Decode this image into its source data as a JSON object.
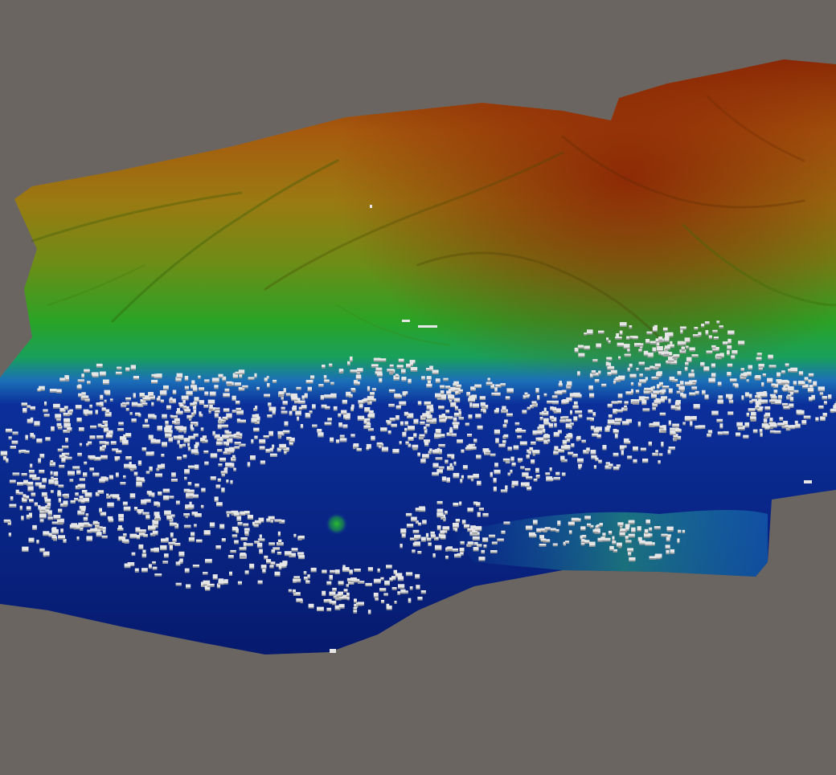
{
  "scene": {
    "background_color": "#6b6561",
    "terrain_color_ramp": [
      "#061a6e",
      "#0b2e9a",
      "#1d8fd0",
      "#1aa83a",
      "#4aa21c",
      "#8a8a14",
      "#a86a10",
      "#8a2a06"
    ],
    "building_color": "#e6e6e6",
    "building_shadow_color": "#9a9a9a"
  }
}
